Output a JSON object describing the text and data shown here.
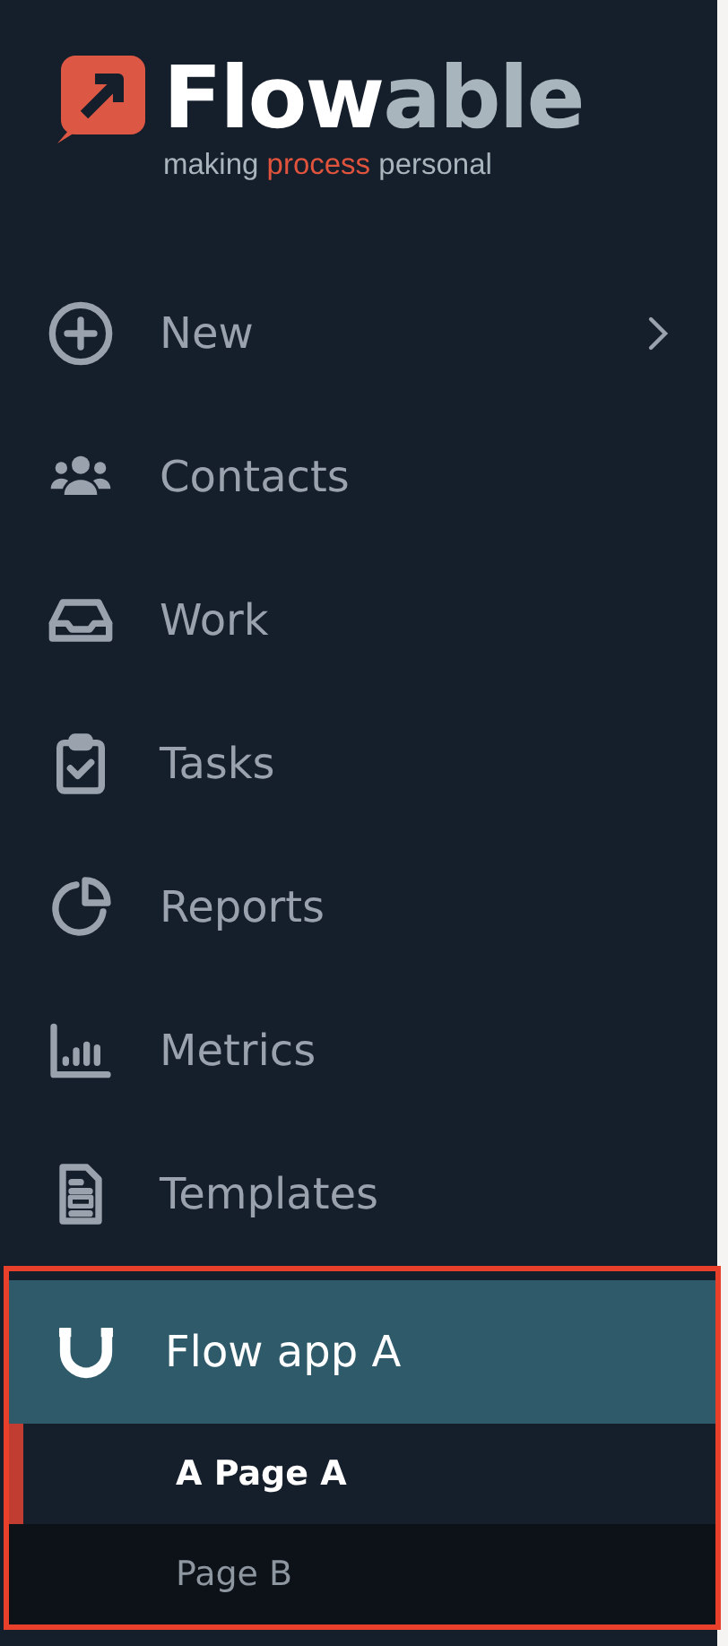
{
  "logo": {
    "word": [
      "Flow",
      "able"
    ],
    "tagline": [
      "making ",
      "process",
      " personal"
    ]
  },
  "nav": [
    {
      "label": "New",
      "has_submenu": true
    },
    {
      "label": "Contacts",
      "has_submenu": false
    },
    {
      "label": "Work",
      "has_submenu": false
    },
    {
      "label": "Tasks",
      "has_submenu": false
    },
    {
      "label": "Reports",
      "has_submenu": false
    },
    {
      "label": "Metrics",
      "has_submenu": false
    },
    {
      "label": "Templates",
      "has_submenu": false
    }
  ],
  "app": {
    "label": "Flow app A",
    "highlighted": true,
    "pages": [
      {
        "label": "A Page A",
        "selected": true
      },
      {
        "label": "Page B",
        "selected": false
      }
    ]
  }
}
